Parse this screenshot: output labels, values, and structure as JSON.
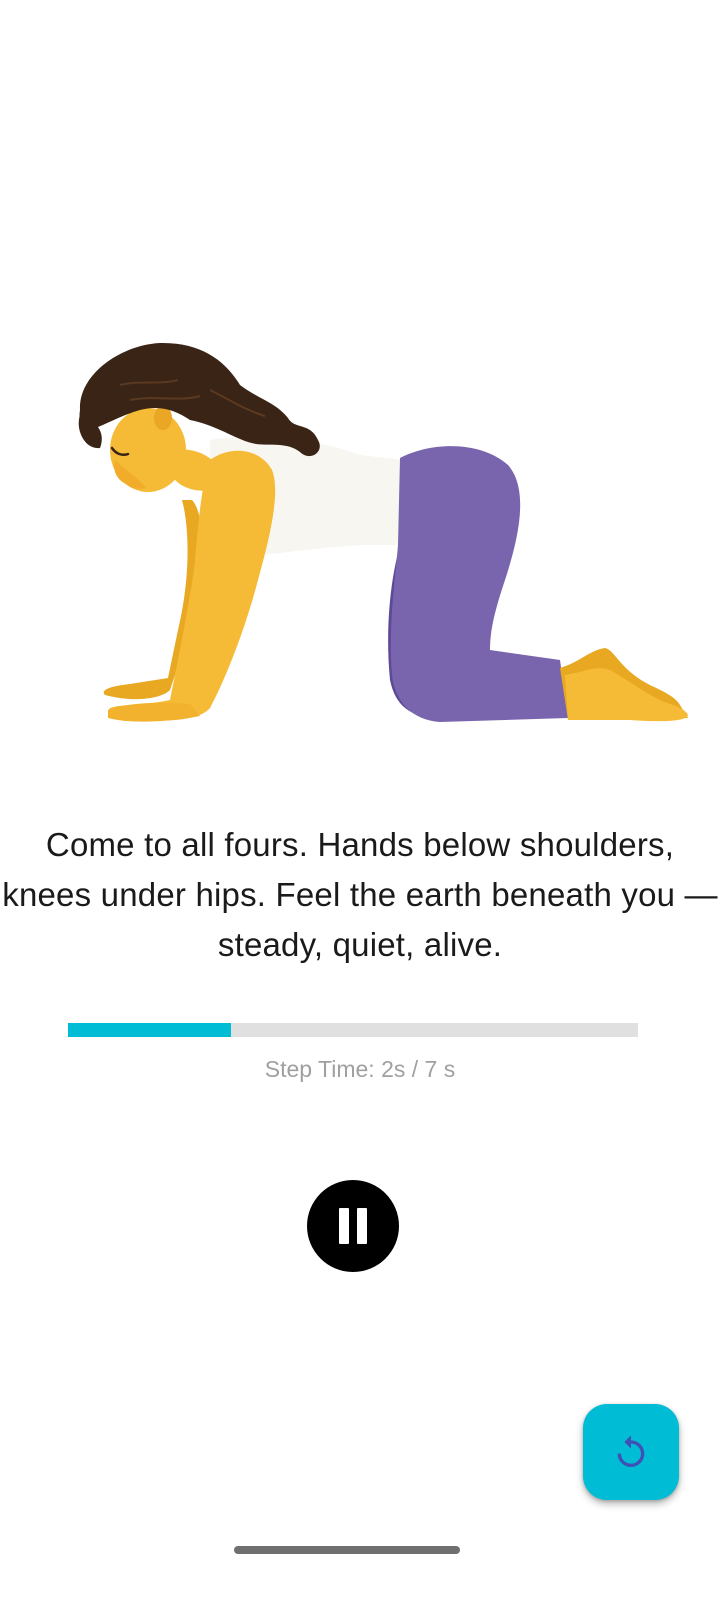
{
  "exercise": {
    "illustration": "woman-on-all-fours-tabletop-pose",
    "instruction": "Come to all fours. Hands below shoulders, knees under hips. Feel the earth beneath you — steady, quiet, alive."
  },
  "timer": {
    "step_time_label": "Step Time: 2s / 7 s",
    "elapsed_seconds": 2,
    "total_seconds": 7,
    "progress_fraction": 0.2857
  },
  "controls": {
    "pause_icon": "pause-icon",
    "restart_icon": "restart-icon"
  },
  "colors": {
    "accent": "#00bcd4",
    "track": "#e0e0e0",
    "control": "#000000",
    "restart_icon": "#3f51b5"
  }
}
